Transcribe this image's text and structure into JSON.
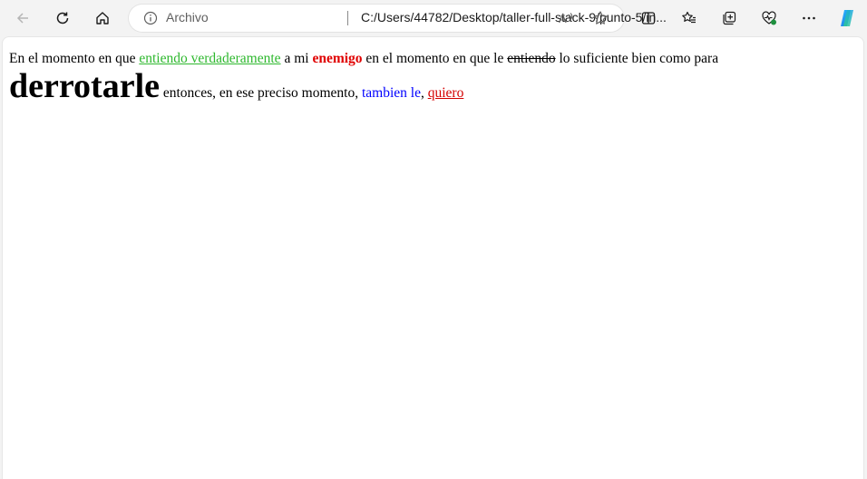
{
  "browser": {
    "address_bar": {
      "site_label": "Archivo",
      "url": "C:/Users/44782/Desktop/taller-full-stack-9/punto-5/in..."
    },
    "icons": {
      "back": "back-arrow-icon",
      "refresh": "refresh-icon",
      "home": "home-icon",
      "info": "info-icon",
      "read_aloud": "read-aloud-icon",
      "favorite": "star-icon",
      "split_screen": "split-screen-icon",
      "favorites": "favorites-list-icon",
      "collections": "collections-icon",
      "performance": "heart-pulse-icon",
      "menu": "more-menu-icon",
      "copilot": "copilot-icon"
    }
  },
  "page": {
    "p1": "En el momento en que ",
    "link_green": "entiendo verdaderamente",
    "p2": " a mi ",
    "bold_red": "enemigo",
    "p3": " en el momento en que le ",
    "strike": "entiendo",
    "p4": " lo suficiente bien como para",
    "big": "derrotarle",
    "p5": " entonces, en ese preciso momento, ",
    "blue": "tambien le",
    "p6": ", ",
    "link_red": "quiero"
  },
  "colors": {
    "green_link": "#2eb82e",
    "red_bold": "#e00000",
    "blue_text": "#0000ff",
    "red_link": "#d40000"
  }
}
